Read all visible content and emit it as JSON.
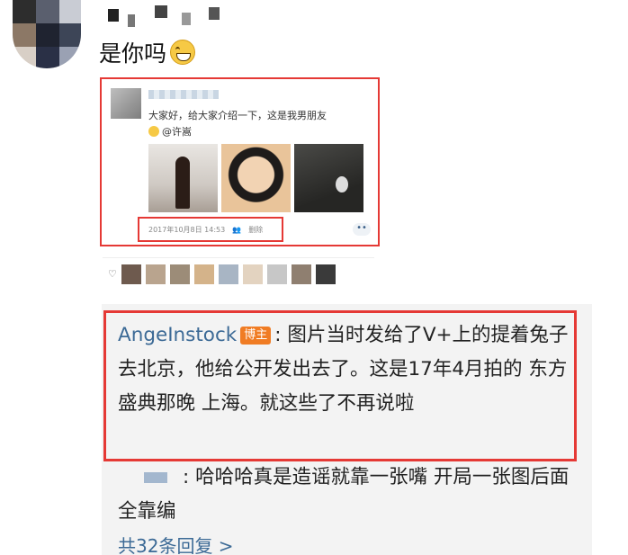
{
  "comment": {
    "text": "是你吗",
    "emoji_icon": "grinning-face-icon"
  },
  "post": {
    "text": "大家好，给大家介绍一下，这是我男朋友",
    "mention": "@许嵩",
    "timestamp": "2017年10月8日 14:53",
    "delete_label": "删除",
    "more_label": "••"
  },
  "likes": {
    "icon": "heart-icon"
  },
  "replies": [
    {
      "author": "AngeInstock",
      "badge": "博主",
      "text": ": 图片当时发给了V+上的提着兔子去北京，他给公开发出去了。这是17年4月拍的 东方盛典那晚 上海。就这些了不再说啦"
    },
    {
      "text": ": 哈哈哈真是造谣就靠一张嘴 开局一张图后面全靠编"
    }
  ],
  "more_replies": "共32条回复 >",
  "colors": {
    "highlight_border": "#e53935",
    "link_blue": "#3c6a96",
    "badge_orange": "#f07c24"
  }
}
